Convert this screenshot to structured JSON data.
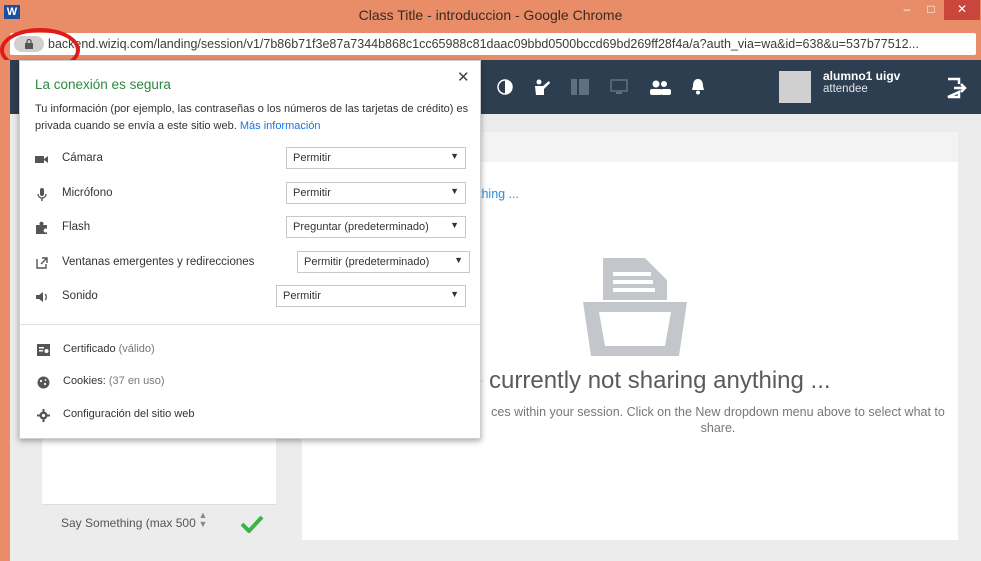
{
  "window": {
    "app_icon_letter": "W",
    "title": "Class Title - introduccion - Google Chrome",
    "min_glyph": "–",
    "max_glyph": "□",
    "close_glyph": "✕"
  },
  "address_bar": {
    "url": "backend.wiziq.com/landing/session/v1/7b86b71f3e87a7344b868c1cc65988c81daac09bbd0500bccd69bd269ff28f4a/a?auth_via=wa&id=638&u=537b77512..."
  },
  "header": {
    "user_name": "alumno1 uigv",
    "user_role": "attendee"
  },
  "site_info_popup": {
    "title": "La conexión es segura",
    "description": "Tu información (por ejemplo, las contraseñas o los números de las tarjetas de crédito) es privada cuando se envía a este sitio web.",
    "more_info_link": "Más información",
    "close_glyph": "✕",
    "permissions": [
      {
        "icon": "camera-icon",
        "label": "Cámara",
        "value": "Permitir"
      },
      {
        "icon": "microphone-icon",
        "label": "Micrófono",
        "value": "Permitir"
      },
      {
        "icon": "puzzle-icon",
        "label": "Flash",
        "value": "Preguntar (predeterminado)"
      },
      {
        "icon": "popup-icon",
        "label": "Ventanas emergentes y redirecciones",
        "value": "Permitir (predeterminado)"
      },
      {
        "icon": "speaker-icon",
        "label": "Sonido",
        "value": "Permitir"
      }
    ],
    "certificate_label": "Certificado",
    "certificate_status": "(válido)",
    "cookies_label": "Cookies:",
    "cookies_status": "(37 en uso)",
    "site_settings_label": "Configuración del sitio web"
  },
  "main": {
    "hint_partial": "thing ...",
    "title_partial": "e currently not sharing anything ...",
    "subtext_partial": "ces within your session. Click on the New dropdown menu above to select what to share."
  },
  "chat": {
    "placeholder": "Say Something (max 500"
  },
  "colors": {
    "titlebar": "#e98d69",
    "header": "#2d3e50",
    "secure": "#2a8a3c",
    "link": "#1a73e8",
    "check": "#3db24a",
    "highlight_circle": "#e01b1b"
  }
}
